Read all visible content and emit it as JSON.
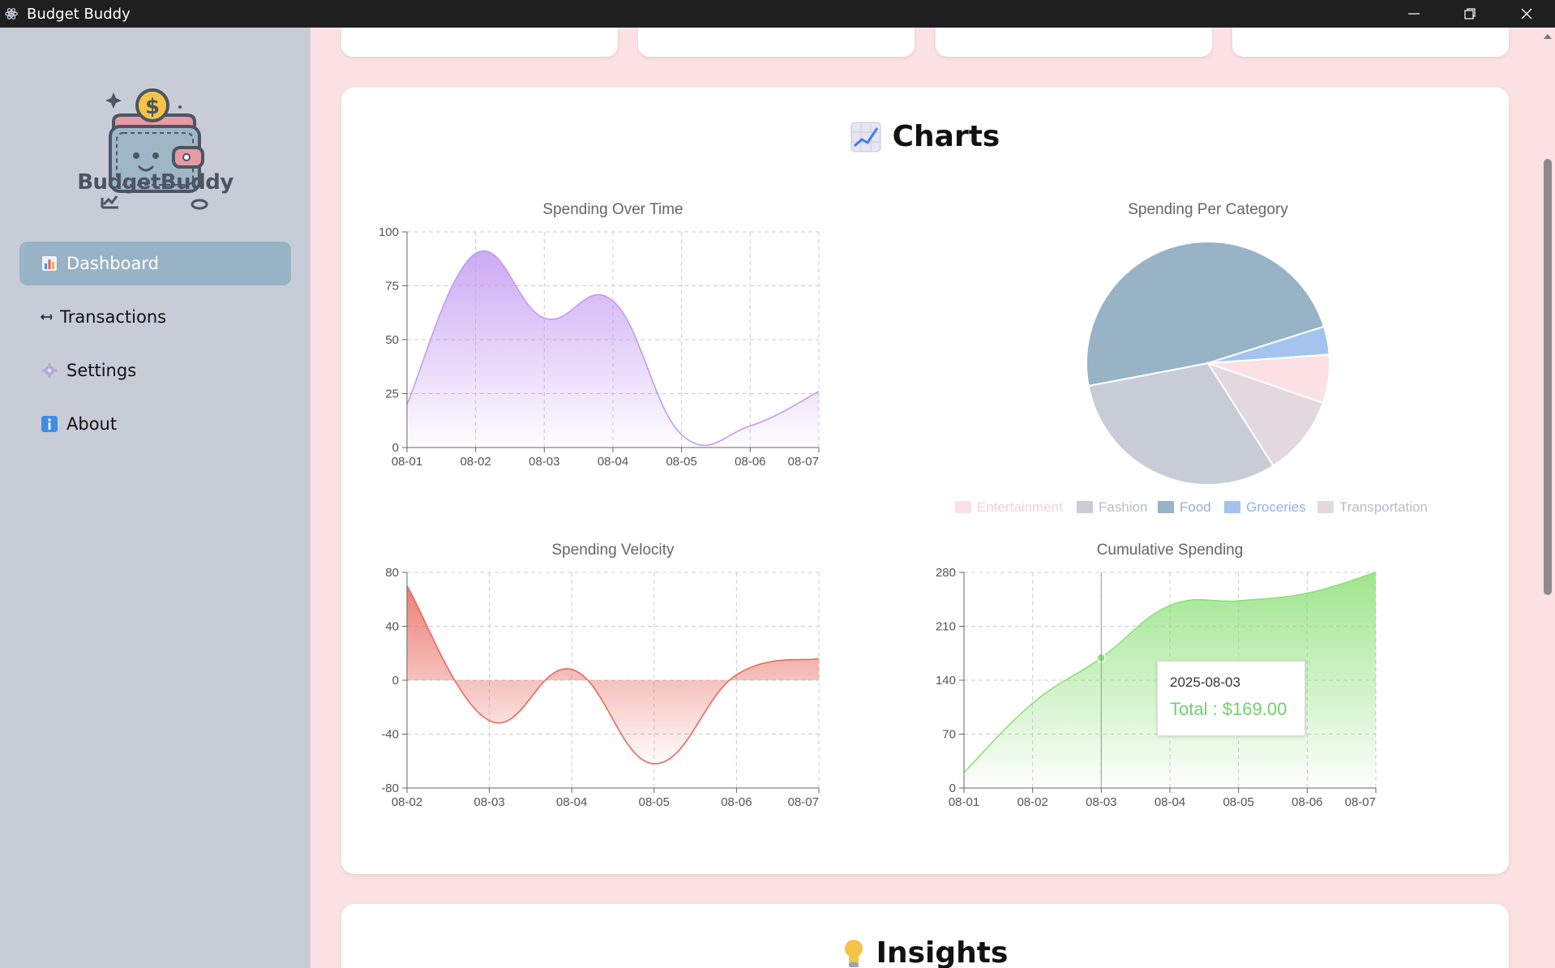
{
  "window": {
    "title": "Budget Buddy"
  },
  "sidebar": {
    "logo_text": "BudgetBuddy",
    "items": [
      {
        "label": "Dashboard",
        "icon": "bar-chart-icon",
        "active": true
      },
      {
        "label": "Transactions",
        "icon": "left-right-arrow-icon",
        "active": false
      },
      {
        "label": "Settings",
        "icon": "gear-icon",
        "active": false
      },
      {
        "label": "About",
        "icon": "info-icon",
        "active": false
      }
    ]
  },
  "charts_section": {
    "title": "Charts",
    "icon": "line-chart-icon"
  },
  "insights_section": {
    "title": "Insights",
    "icon": "lightbulb-icon"
  },
  "tooltip": {
    "date": "2025-08-03",
    "text": "Total : $169.00"
  },
  "colors": {
    "sidebar_bg": "#c8ccd7",
    "active_nav": "#98b2c6",
    "page_bg": "#fbe1e3",
    "spending_purple": "#c39bf2",
    "velocity_red": "#e8695e",
    "cumulative_green": "#8ee07a"
  },
  "chart_data": [
    {
      "type": "area",
      "title": "Spending Over Time",
      "x": [
        "08-01",
        "08-02",
        "08-03",
        "08-04",
        "08-05",
        "08-06",
        "08-07"
      ],
      "series": [
        {
          "values": [
            20,
            90,
            60,
            68,
            6,
            10,
            26
          ]
        }
      ],
      "ylim": [
        0,
        100
      ],
      "yticks": [
        0,
        25,
        50,
        75,
        100
      ],
      "grid": true
    },
    {
      "type": "pie",
      "title": "Spending Per Category",
      "labels": [
        "Entertainment",
        "Fashion",
        "Food",
        "Groceries",
        "Transportation"
      ],
      "values": [
        6,
        29,
        45,
        3.5,
        10
      ],
      "colors": [
        "#fbe1e3",
        "#c8ccd7",
        "#98b2c6",
        "#a3c4ee",
        "#e2d8dd"
      ],
      "legend": "bottom"
    },
    {
      "type": "area",
      "title": "Spending Velocity",
      "x": [
        "08-02",
        "08-03",
        "08-04",
        "08-05",
        "08-06",
        "08-07"
      ],
      "series": [
        {
          "values": [
            70,
            -30,
            8,
            -62,
            4,
            16
          ]
        }
      ],
      "ylim": [
        -80,
        80
      ],
      "yticks": [
        -80,
        -40,
        0,
        40,
        80
      ],
      "grid": true
    },
    {
      "type": "area",
      "title": "Cumulative Spending",
      "x": [
        "08-01",
        "08-02",
        "08-03",
        "08-04",
        "08-05",
        "08-06",
        "08-07"
      ],
      "series": [
        {
          "values": [
            20,
            110,
            169,
            237,
            243,
            253,
            280
          ]
        }
      ],
      "ylim": [
        0,
        280
      ],
      "yticks": [
        0,
        70,
        140,
        210,
        280
      ],
      "grid": true
    }
  ]
}
